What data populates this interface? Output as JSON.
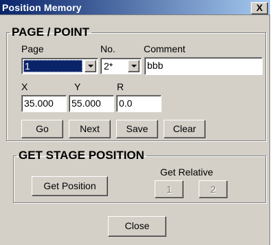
{
  "window": {
    "title": "Position Memory",
    "close_label": "X"
  },
  "page_point": {
    "legend": "PAGE / POINT",
    "page_label": "Page",
    "page_value": "1",
    "no_label": "No.",
    "no_value": "2*",
    "comment_label": "Comment",
    "comment_value": "bbb",
    "x_label": "X",
    "x_value": "35.000",
    "y_label": "Y",
    "y_value": "55.000",
    "r_label": "R",
    "r_value": "0.0",
    "buttons": {
      "go": "Go",
      "next": "Next",
      "save": "Save",
      "clear": "Clear"
    }
  },
  "stage": {
    "legend": "GET STAGE POSITION",
    "get_position": "Get Position",
    "get_relative_label": "Get Relative",
    "relative_1": "1",
    "relative_2": "2"
  },
  "footer": {
    "close": "Close"
  }
}
